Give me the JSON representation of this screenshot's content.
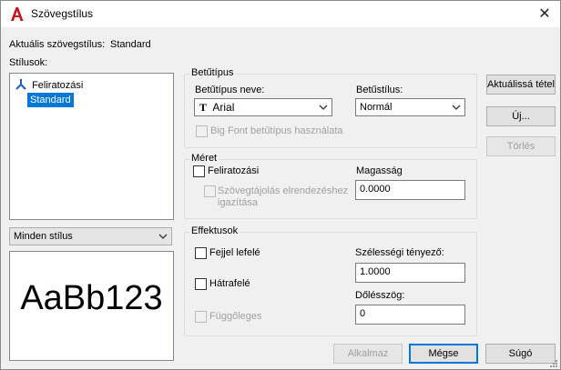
{
  "window": {
    "title": "Szövegstílus",
    "close_glyph": "✕"
  },
  "current_style": {
    "label": "Aktuális szövegstílus:",
    "value": "Standard"
  },
  "styles": {
    "label": "Stílusok:",
    "items": [
      {
        "name": "Feliratozási",
        "icon": "annotative-icon",
        "selected": false
      },
      {
        "name": "Standard",
        "selected": true
      }
    ],
    "filter": "Minden stílus"
  },
  "preview": {
    "text": "AaBb123"
  },
  "font": {
    "group_title": "Betűtípus",
    "font_name_label": "Betűtípus neve:",
    "font_name_value": "Arial",
    "font_style_label": "Betűstílus:",
    "font_style_value": "Normál",
    "big_font_label": "Big Font betűtípus használata"
  },
  "size": {
    "group_title": "Méret",
    "annotative_label": "Feliratozási",
    "match_orientation_label_1": "Szövegtájolás elrendezéshez",
    "match_orientation_label_2": "igazítása",
    "height_label": "Magasság",
    "height_value": "0.0000"
  },
  "effects": {
    "group_title": "Effektusok",
    "upside_down_label": "Fejjel lefelé",
    "backwards_label": "Hátrafelé",
    "vertical_label": "Függőleges",
    "width_factor_label": "Szélességi tényező:",
    "width_factor_value": "1.0000",
    "oblique_label": "Dőlésszög:",
    "oblique_value": "0"
  },
  "buttons": {
    "set_current": "Aktuálissá tétel",
    "new": "Új...",
    "delete": "Törlés",
    "apply": "Alkalmaz",
    "cancel": "Mégse",
    "help": "Súgó"
  },
  "colors": {
    "accent": "#0078d7",
    "brand_red": "#c4161c"
  }
}
